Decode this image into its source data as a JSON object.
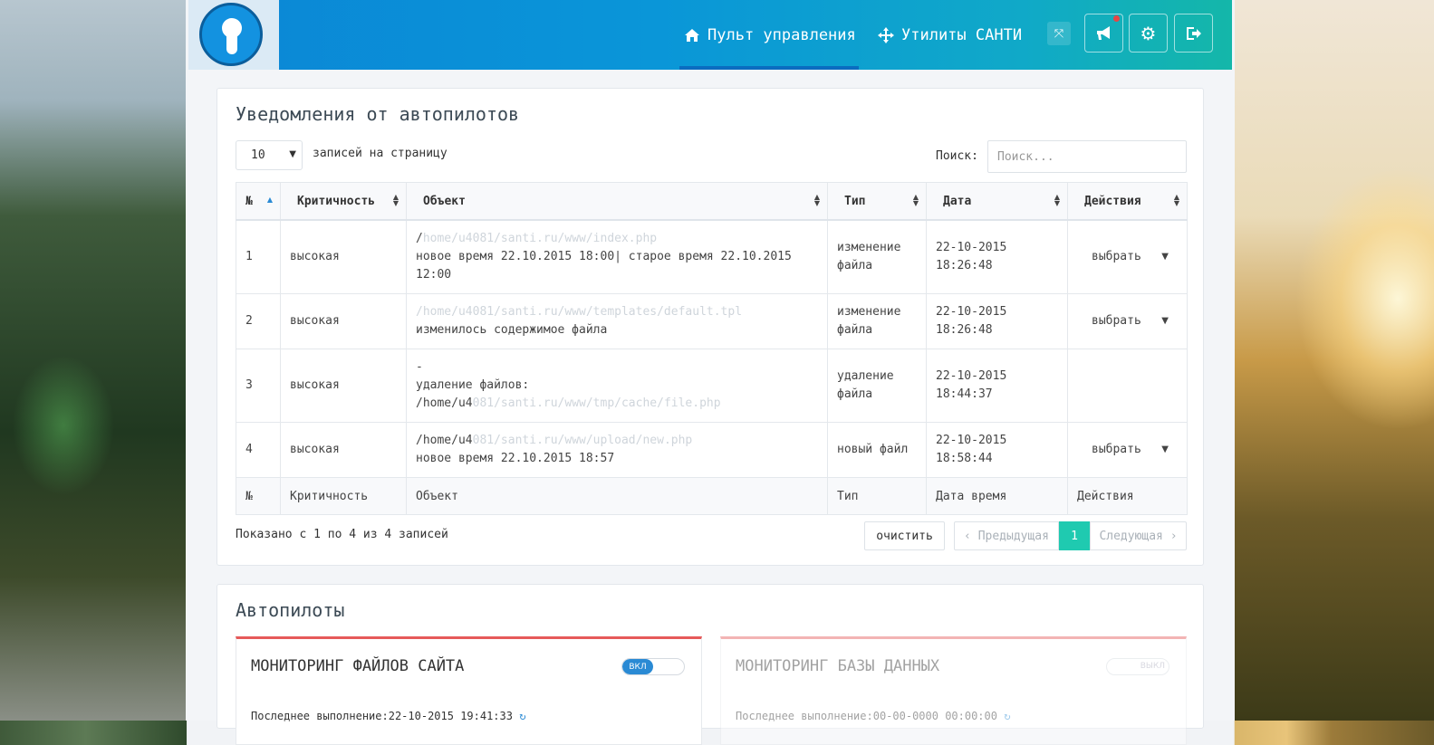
{
  "nav": {
    "dashboard_label": "Пульт управления",
    "utilities_label": "Утилиты САНТИ"
  },
  "notifications_panel": {
    "title": "Уведомления от автопилотов",
    "page_length_value": "10",
    "page_length_label": "записей на страницу",
    "search_label": "Поиск:",
    "search_placeholder": "Поиск...",
    "columns": [
      "№",
      "Критичность",
      "Объект",
      "Тип",
      "Дата",
      "Действия"
    ],
    "footer_columns": [
      "№",
      "Критичность",
      "Объект",
      "Тип",
      "Дата время",
      "Действия"
    ],
    "rows": [
      {
        "num": "1",
        "severity": "высокая",
        "object_path": "/",
        "object_path_hidden": "home/u4081/santi.ru/www/index.php",
        "object_detail": "новое время 22.10.2015 18:00| старое время 22.10.2015 12:00",
        "type": "изменение файла",
        "date": "22-10-2015 18:26:48",
        "action": "выбрать"
      },
      {
        "num": "2",
        "severity": "высокая",
        "object_path": "",
        "object_path_hidden": "/home/u4081/santi.ru/www/templates/default.tpl",
        "object_detail": "изменилось содержимое файла",
        "type": "изменение файла",
        "date": "22-10-2015 18:26:48",
        "action": "выбрать"
      },
      {
        "num": "3",
        "severity": "высокая",
        "object_path": "-",
        "object_path_hidden": "",
        "object_detail": "удаление файлов:",
        "object_detail2": "/home/u4",
        "object_detail2_hidden": "081/santi.ru/www/tmp/cache/file.php",
        "type": "удаление файла",
        "date": "22-10-2015 18:44:37",
        "action": ""
      },
      {
        "num": "4",
        "severity": "высокая",
        "object_path": "/home/u4",
        "object_path_hidden": "081/santi.ru/www/upload/new.php",
        "object_detail": "новое время 22.10.2015 18:57",
        "type": "новый файл",
        "date": "22-10-2015 18:58:44",
        "action": "выбрать"
      }
    ],
    "info_text": "Показано с 1 по 4 из 4 записей",
    "clear_label": "очистить",
    "prev_label": "Предыдущая",
    "current_page": "1",
    "next_label": "Следующая"
  },
  "autopilots_panel": {
    "title": "Автопилоты",
    "cards": [
      {
        "title": "МОНИТОРИНГ ФАЙЛОВ САЙТА",
        "toggle_label": "ВКЛ",
        "last_run": "Последнее выполнение:22-10-2015 19:41:33"
      },
      {
        "title": "МОНИТОРИНГ БАЗЫ ДАННЫХ",
        "toggle_label": "ВЫКЛ",
        "last_run": "Последнее выполнение:00-00-0000 00:00:00"
      }
    ]
  },
  "icons": [
    "home-icon",
    "move-icon",
    "expand-icon",
    "megaphone-icon",
    "gears-icon",
    "logout-icon",
    "refresh-icon"
  ],
  "colors": {
    "accent": "#1fcab0",
    "header_start": "#0b86d6",
    "header_end": "#14b7a9",
    "alert_top": "#e65a5a",
    "toggle_on": "#2a8ad4"
  }
}
